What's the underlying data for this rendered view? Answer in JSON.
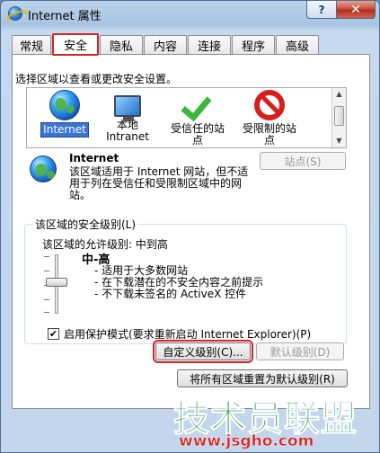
{
  "window": {
    "title": "Internet 属性",
    "help_label": "?",
    "close_label": "✕"
  },
  "tabs": [
    "常规",
    "安全",
    "隐私",
    "内容",
    "连接",
    "程序",
    "高级"
  ],
  "security": {
    "heading": "选择区域以查看或更改安全设置。",
    "zones": [
      {
        "label": "Internet",
        "icon": "globe-icon",
        "selected": true
      },
      {
        "label": "本地\nIntranet",
        "icon": "intranet-icon",
        "selected": false
      },
      {
        "label": "受信任的站\n点",
        "icon": "trusted-icon",
        "selected": false
      },
      {
        "label": "受限制的站\n点",
        "icon": "restricted-icon",
        "selected": false
      }
    ],
    "selected_zone_name": "Internet",
    "selected_zone_desc": "该区域适用于 Internet 网站，但不适用于列在受信任和受限制区域中的网站。",
    "sites_button": "站点(S)",
    "level_group_title": "该区域的安全级别(L)",
    "allowed_level": "该区域的允许级别: 中到高",
    "level_name": "中-高",
    "level_bullets": [
      "- 适用于大多数网站",
      "- 在下载潜在的不安全内容之前提示",
      "- 不下载未签名的 ActiveX 控件"
    ],
    "slider_level": 0.5,
    "protected_mode_label": "启用保护模式(要求重新启动 Internet Explorer)(P)",
    "protected_mode_checked": true,
    "custom_level_button": "自定义级别(C)...",
    "default_level_button": "默认级别(D)",
    "reset_all_button": "将所有区域重置为默认级别(R)"
  },
  "watermark": {
    "text": "技术员联盟",
    "url": "www.jsgho.com"
  },
  "colors": {
    "accent_red": "#d42424",
    "selection_blue": "#3875d7",
    "watermark_green": "#1e9a52"
  }
}
